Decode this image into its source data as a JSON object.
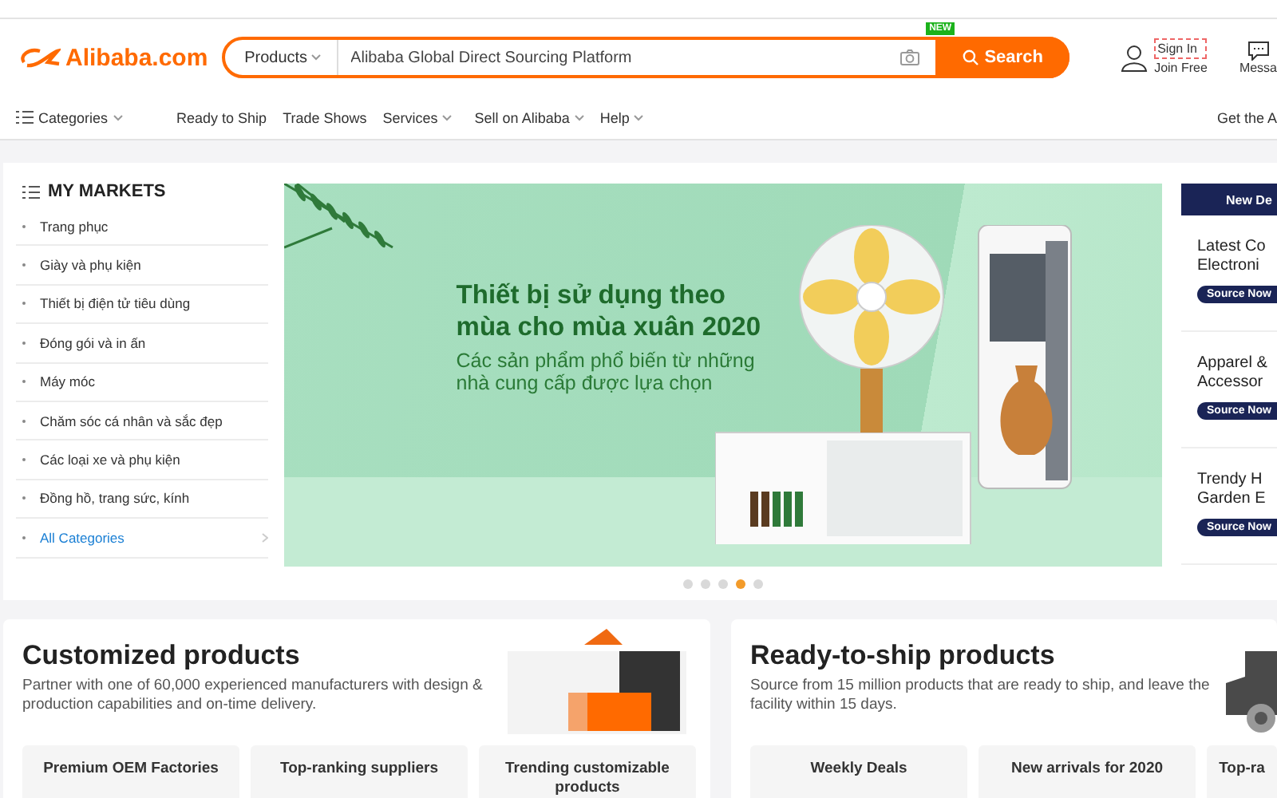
{
  "header": {
    "logo": "Alibaba.com",
    "search": {
      "category": "Products",
      "placeholder": "Alibaba Global Direct Sourcing Platform",
      "badge": "NEW",
      "button": "Search"
    },
    "account": {
      "sign_in": "Sign In",
      "join": "Join Free"
    },
    "messages": "Messa"
  },
  "nav": {
    "items": [
      {
        "label": "Categories",
        "kind": "menu"
      },
      {
        "label": "Ready to Ship",
        "kind": "link"
      },
      {
        "label": "Trade Shows",
        "kind": "link"
      },
      {
        "label": "Services",
        "kind": "dropdown"
      },
      {
        "label": "Sell on Alibaba",
        "kind": "dropdown"
      },
      {
        "label": "Help",
        "kind": "dropdown"
      }
    ],
    "right": "Get the A"
  },
  "markets": {
    "title": "MY MARKETS",
    "items": [
      {
        "label": "Trang phục",
        "kind": "category"
      },
      {
        "label": "Giày và phụ kiện",
        "kind": "category"
      },
      {
        "label": "Thiết bị điện tử tiêu dùng",
        "kind": "category"
      },
      {
        "label": "Đóng gói và in ấn",
        "kind": "category"
      },
      {
        "label": "Máy móc",
        "kind": "category"
      },
      {
        "label": "Chăm sóc cá nhân và sắc đẹp",
        "kind": "category"
      },
      {
        "label": "Các loại xe và phụ kiện",
        "kind": "category"
      },
      {
        "label": "Đồng hồ, trang sức, kính",
        "kind": "category"
      },
      {
        "label": "All Categories",
        "kind": "all"
      }
    ]
  },
  "banner": {
    "headline": "Thiết bị sử dụng theo mùa cho mùa xuân 2020",
    "subline": "Các sản phẩm phổ biến từ những nhà cung cấp được lựa chọn",
    "slides": [
      {
        "selected": false
      },
      {
        "selected": false
      },
      {
        "selected": false
      },
      {
        "selected": true
      },
      {
        "selected": false
      }
    ]
  },
  "deals": {
    "title": "New De",
    "items": [
      {
        "lines": [
          "Latest Co",
          "Electroni"
        ],
        "button": "Source Now"
      },
      {
        "lines": [
          "Apparel &",
          "Accessor"
        ],
        "button": "Source Now"
      },
      {
        "lines": [
          "Trendy H",
          "Garden E"
        ],
        "button": "Source Now"
      }
    ]
  },
  "cards": [
    {
      "kind": "custom",
      "title": "Customized products",
      "description": "Partner with one of 60,000 experienced manufacturers with design & production capabilities and on-time delivery.",
      "links": [
        "Premium OEM Factories",
        "Top-ranking suppliers",
        "Trending customizable products"
      ]
    },
    {
      "kind": "ship",
      "title": "Ready-to-ship products",
      "description": "Source from 15 million products that are ready to ship, and leave the facility within 15 days.",
      "links": [
        "Weekly Deals",
        "New arrivals for 2020",
        "Top-ra"
      ]
    }
  ]
}
